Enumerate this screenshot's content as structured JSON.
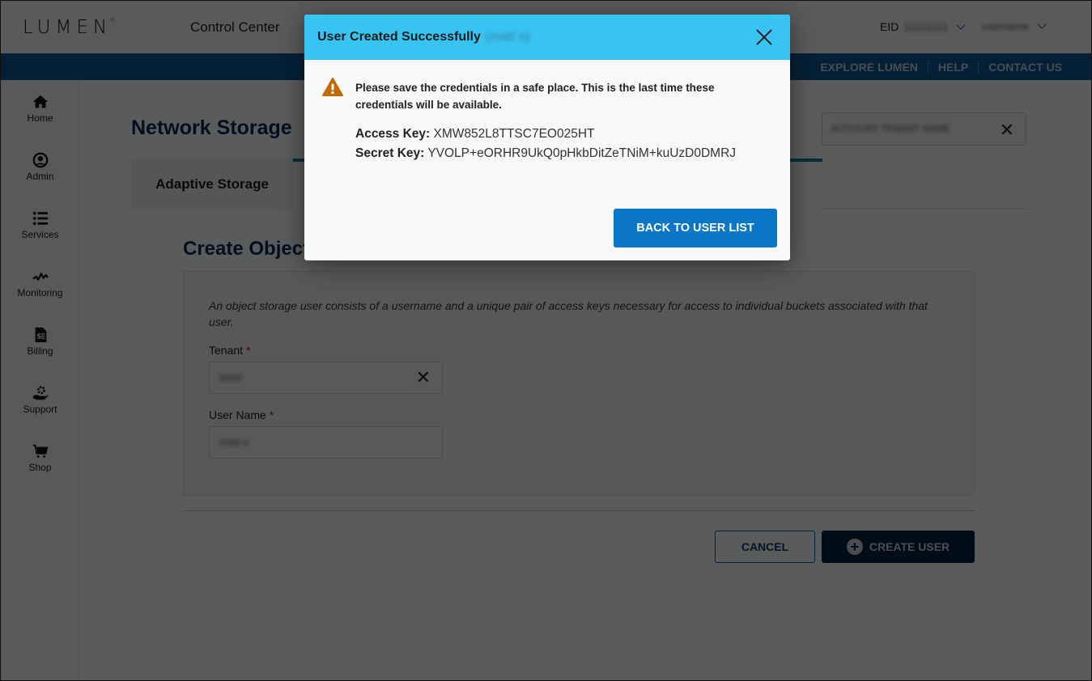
{
  "header": {
    "logo": "LUMEN",
    "app_title": "Control Center",
    "eid_label": "EID",
    "eid_value": "11111111",
    "user_name": "username"
  },
  "subnav": {
    "items": [
      "EXPLORE LUMEN",
      "HELP",
      "CONTACT US"
    ]
  },
  "sidebar": {
    "items": [
      {
        "label": "Home",
        "icon": "home-icon"
      },
      {
        "label": "Admin",
        "icon": "user-circle-icon"
      },
      {
        "label": "Services",
        "icon": "list-icon"
      },
      {
        "label": "Monitoring",
        "icon": "pulse-icon"
      },
      {
        "label": "Billing",
        "icon": "invoice-icon"
      },
      {
        "label": "Support",
        "icon": "support-icon"
      },
      {
        "label": "Shop",
        "icon": "cart-icon"
      }
    ]
  },
  "main": {
    "page_title": "Network Storage",
    "tabs": [
      {
        "label": "Adaptive Storage"
      }
    ],
    "tenant_selector_value": "ACCOUNT TENANT NAME",
    "form_title": "Create Object Storage User",
    "description": "An object storage user consists of a username and a unique pair of access keys necessary for access to individual buckets associated with that user.",
    "tenant_label": "Tenant",
    "tenant_value": "test2",
    "username_label": "User Name",
    "username_value": "matt o",
    "required_mark": "*",
    "cancel_label": "CANCEL",
    "create_label": "CREATE USER"
  },
  "modal": {
    "title": "User Created Successfully",
    "title_user": "(matt o)",
    "warning": "Please save the credentials in a safe place. This is the last time these credentials will be available.",
    "access_key_label": "Access Key:",
    "access_key_value": "XMW852L8TTSC7EO025HT",
    "secret_key_label": "Secret Key:",
    "secret_key_value": "YVOLP+eORHR9UkQ0pHkbDitZeTNiM+kuUzD0DMRJ",
    "back_label": "BACK TO USER LIST"
  },
  "colors": {
    "modal_header": "#38c4f2",
    "primary_button": "#0a76c8",
    "brand_navy": "#032347",
    "warning": "#c06a00"
  }
}
